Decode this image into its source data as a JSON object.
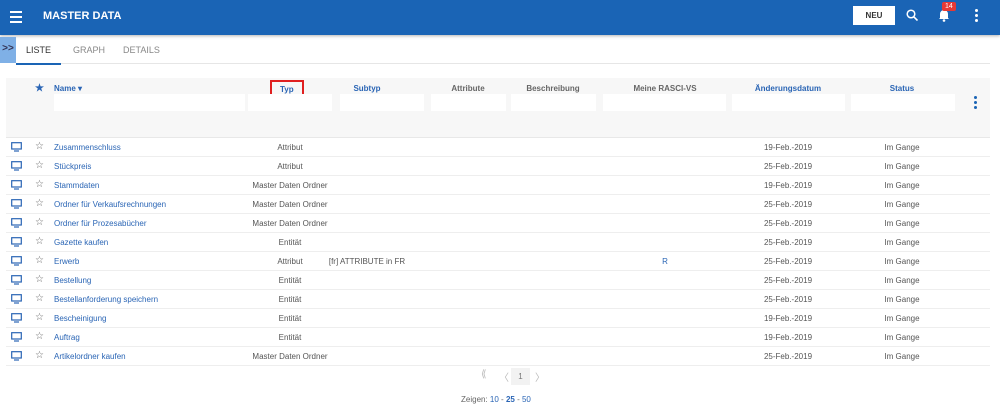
{
  "header": {
    "title": "MASTER DATA",
    "new_label": "NEU",
    "notification_count": "14"
  },
  "tabs": [
    "LISTE",
    "GRAPH",
    "DETAILS"
  ],
  "columns": {
    "name": "Name",
    "typ": "Typ",
    "subtyp": "Subtyp",
    "attribute": "Attribute",
    "beschreibung": "Beschreibung",
    "rasci": "Meine RASCI-VS",
    "datum": "Änderungsdatum",
    "status": "Status"
  },
  "rows": [
    {
      "name": "Zusammenschluss",
      "typ": "Attribut",
      "subtyp": "",
      "rasci": "",
      "datum": "19-Feb.-2019",
      "status": "Im Gange"
    },
    {
      "name": "Stückpreis",
      "typ": "Attribut",
      "subtyp": "",
      "rasci": "",
      "datum": "25-Feb.-2019",
      "status": "Im Gange"
    },
    {
      "name": "Stammdaten",
      "typ": "Master Daten Ordner",
      "subtyp": "",
      "rasci": "",
      "datum": "19-Feb.-2019",
      "status": "Im Gange"
    },
    {
      "name": "Ordner für Verkaufsrechnungen",
      "typ": "Master Daten Ordner",
      "subtyp": "",
      "rasci": "",
      "datum": "25-Feb.-2019",
      "status": "Im Gange"
    },
    {
      "name": "Ordner für Prozesabücher",
      "typ": "Master Daten Ordner",
      "subtyp": "",
      "rasci": "",
      "datum": "25-Feb.-2019",
      "status": "Im Gange"
    },
    {
      "name": "Gazette kaufen",
      "typ": "Entität",
      "subtyp": "",
      "rasci": "",
      "datum": "25-Feb.-2019",
      "status": "Im Gange"
    },
    {
      "name": "Erwerb",
      "typ": "Attribut",
      "subtyp": "[fr] ATTRIBUTE in FR",
      "rasci": "R",
      "datum": "25-Feb.-2019",
      "status": "Im Gange"
    },
    {
      "name": "Bestellung",
      "typ": "Entität",
      "subtyp": "",
      "rasci": "",
      "datum": "25-Feb.-2019",
      "status": "Im Gange"
    },
    {
      "name": "Bestellanforderung speichern",
      "typ": "Entität",
      "subtyp": "",
      "rasci": "",
      "datum": "25-Feb.-2019",
      "status": "Im Gange"
    },
    {
      "name": "Bescheinigung",
      "typ": "Entität",
      "subtyp": "",
      "rasci": "",
      "datum": "19-Feb.-2019",
      "status": "Im Gange"
    },
    {
      "name": "Auftrag",
      "typ": "Entität",
      "subtyp": "",
      "rasci": "",
      "datum": "19-Feb.-2019",
      "status": "Im Gange"
    },
    {
      "name": "Artikelordner kaufen",
      "typ": "Master Daten Ordner",
      "subtyp": "",
      "rasci": "",
      "datum": "25-Feb.-2019",
      "status": "Im Gange"
    }
  ],
  "pagination": {
    "current": "1",
    "show_label": "Zeigen:",
    "sizes": [
      "10",
      "25",
      "50"
    ]
  },
  "colors": {
    "primary": "#1a64b5",
    "highlight": "#e02020"
  }
}
